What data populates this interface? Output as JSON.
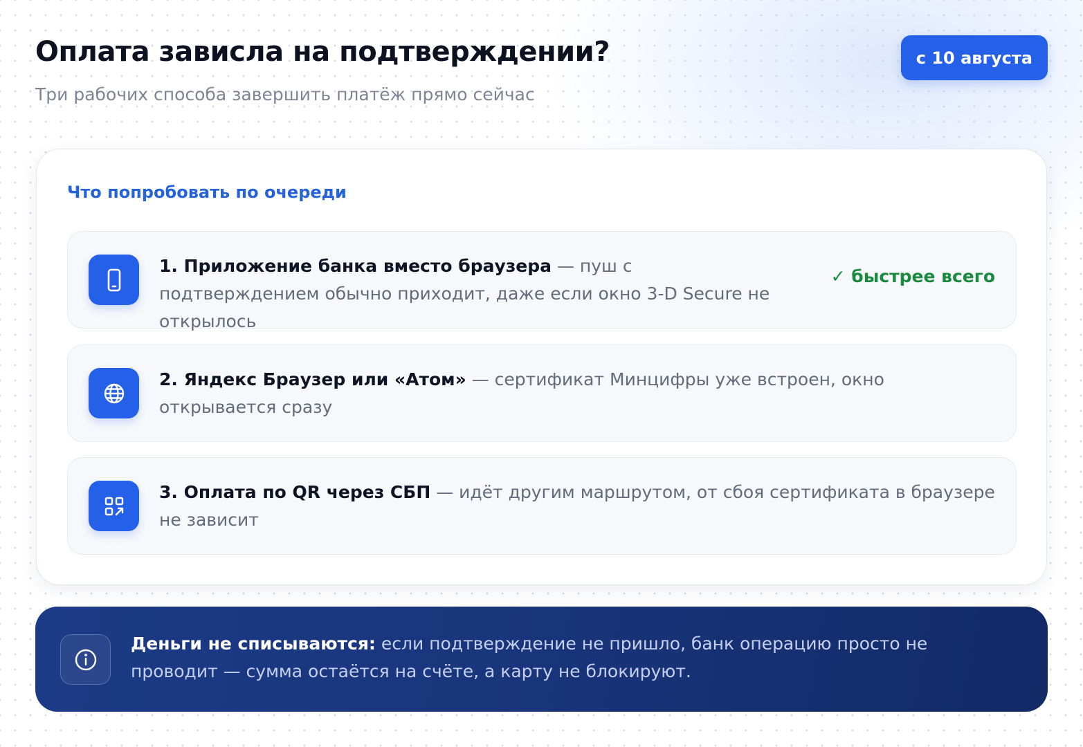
{
  "header": {
    "title": "Оплата зависла на подтверждении?",
    "subtitle": "Три рабочих способа завершить платёж прямо сейчас",
    "badge": "с 10 августа"
  },
  "card": {
    "heading": "Что попробовать по очереди",
    "steps": [
      {
        "title": "1. Приложение банка вместо браузера",
        "text": " — пуш с подтверждением обычно приходит, даже если окно 3-D Secure не открылось",
        "badge": "✓ быстрее всего",
        "icon": "smartphone-icon"
      },
      {
        "title": "2. Яндекс Браузер или «Атом»",
        "text": " — сертификат Минцифры уже встроен, окно открывается сразу",
        "icon": "globe-icon"
      },
      {
        "title": "3. Оплата по QR через СБП",
        "text": " — идёт другим маршрутом, от сбоя сертификата в браузере не зависит",
        "icon": "qr-code-icon"
      }
    ]
  },
  "info": {
    "strong": "Деньги не списываются:",
    "text": " если подтверждение не пришло, банк операцию просто не проводит — сумма остаётся на счёте, а карту не блокируют.",
    "icon": "info-icon"
  },
  "colors": {
    "accent": "#2560e8",
    "heading_blue": "#2663d9",
    "success": "#198a3e",
    "banner": "#19357c"
  }
}
